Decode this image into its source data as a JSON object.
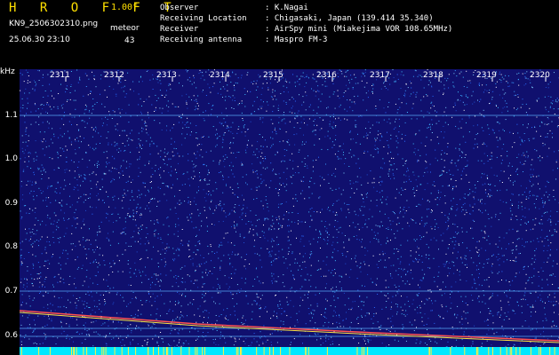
{
  "header": {
    "app_name": "H R O F F T",
    "version": "1.00f",
    "filename": "KN9_2506302310.png",
    "datetime": "25.06.30 23:10",
    "count_label": "meteor",
    "count_value": "43"
  },
  "station": {
    "observer_label": "Observer",
    "observer_value": ": K.Nagai",
    "location_label": "Receiving Location",
    "location_value": ": Chigasaki, Japan (139.414 35.340)",
    "receiver_label": "Receiver",
    "receiver_value": ": AirSpy mini (Miakejima VOR 108.65MHz)",
    "antenna_label": "Receiving antenna",
    "antenna_value": ": Maspro FM-3"
  },
  "axis": {
    "unit": "kHz",
    "y_ticks": [
      "1.1",
      "1.0",
      "0.9",
      "0.8",
      "0.7",
      "0.6"
    ],
    "x_ticks": [
      "2311",
      "2312",
      "2313",
      "2314",
      "2315",
      "2316",
      "2317",
      "2318",
      "2319",
      "2320"
    ]
  },
  "colors": {
    "background": "#10106e",
    "noise": "#3aa0ff",
    "header_accent": "#ffe000",
    "baseline": "#00e8ff"
  }
}
